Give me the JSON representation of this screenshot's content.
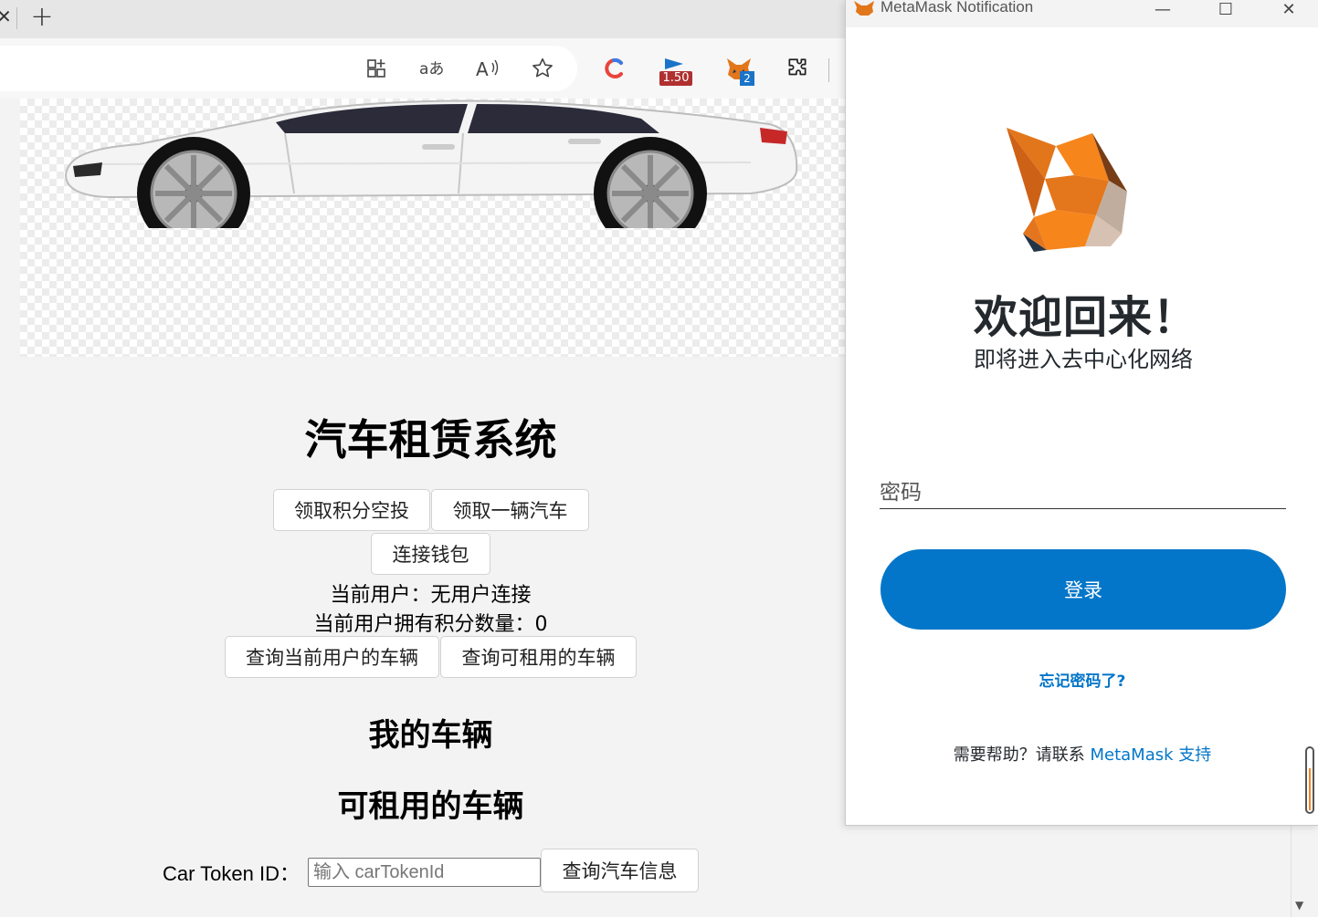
{
  "browser": {
    "new_tab_label": "+",
    "extensions": {
      "video_speed_badge": "1.50",
      "metamask_badge": "2"
    }
  },
  "page": {
    "title": "汽车租赁系统",
    "buttons": {
      "claim_points": "领取积分空投",
      "claim_car": "领取一辆汽车",
      "connect_wallet": "连接钱包",
      "query_my_cars": "查询当前用户的车辆",
      "query_available": "查询可租用的车辆",
      "query_car_info": "查询汽车信息"
    },
    "current_user": "当前用户：无用户连接",
    "current_points": "当前用户拥有积分数量：0",
    "my_cars_heading": "我的车辆",
    "available_cars_heading": "可租用的车辆",
    "token_label": "Car Token ID：",
    "token_placeholder": "输入 carTokenId"
  },
  "metamask": {
    "window_title": "MetaMask Notification",
    "welcome": "欢迎回来！",
    "subtitle": "即将进入去中心化网络",
    "password_label": "密码",
    "login_button": "登录",
    "forgot_password": "忘记密码了?",
    "help_prefix": "需要帮助？请联系 ",
    "help_link": "MetaMask 支持",
    "colors": {
      "primary": "#0376c9",
      "fox_orange": "#f6851b"
    }
  }
}
